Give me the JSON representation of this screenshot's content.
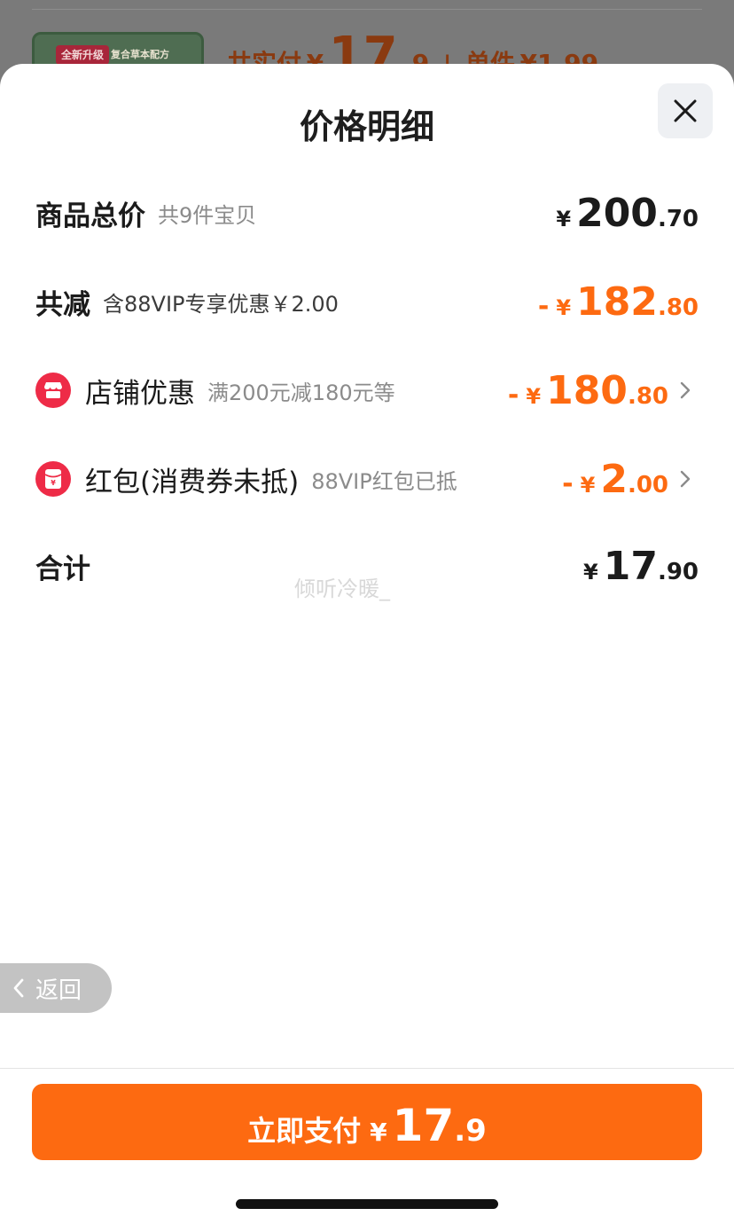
{
  "background": {
    "thumb_badge": "全新升级",
    "thumb_label": "复合草本配方",
    "paid_label": "共实付",
    "paid_currency": "¥",
    "paid_int": "17",
    "paid_dec": ".9",
    "unit_label": "单件",
    "unit_price": "¥1.99"
  },
  "sheet": {
    "title": "价格明细",
    "close_icon": "close-icon"
  },
  "rows": {
    "subtotal": {
      "title": "商品总价",
      "sub": "共9件宝贝",
      "currency": "¥",
      "int": "200",
      "dec": ".70"
    },
    "discount": {
      "title": "共减",
      "sub": "含88VIP专享优惠￥2.00",
      "minus": "-",
      "currency": "¥",
      "int": "182",
      "dec": ".80"
    },
    "shop": {
      "title": "店铺优惠",
      "sub": "满200元减180元等",
      "minus": "-",
      "currency": "¥",
      "int": "180",
      "dec": ".80",
      "icon": "shop-icon"
    },
    "redpacket": {
      "title": "红包(消费券未抵)",
      "sub": "88VIP红包已抵",
      "minus": "-",
      "currency": "¥",
      "int": "2",
      "dec": ".00",
      "icon": "red-packet-icon"
    },
    "total": {
      "title": "合计",
      "currency": "¥",
      "int": "17",
      "dec": ".90"
    }
  },
  "watermark": "倾听冷暖_",
  "back": {
    "label": "返回"
  },
  "pay": {
    "label": "立即支付",
    "currency": "¥",
    "int": "17",
    "dec": ".9"
  },
  "colors": {
    "accent": "#fd6a11",
    "icon_red": "#ee2b47"
  }
}
